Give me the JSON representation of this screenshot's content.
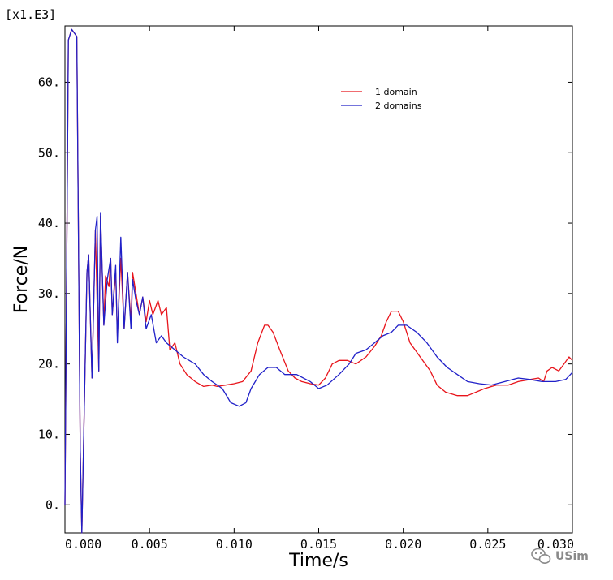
{
  "chart_data": {
    "type": "line",
    "xlabel": "Time/s",
    "ylabel": "Force/N",
    "y_multiplier": "[x1.E3]",
    "xlim": [
      0.0,
      0.03
    ],
    "ylim": [
      -4,
      68
    ],
    "x_ticks": [
      0.0,
      0.005,
      0.01,
      0.015,
      0.02,
      0.025,
      0.03
    ],
    "x_tick_labels": [
      "0.000",
      "0.005",
      "0.010",
      "0.015",
      "0.020",
      "0.025",
      "0.030"
    ],
    "y_ticks": [
      0,
      10,
      20,
      30,
      40,
      50,
      60
    ],
    "y_tick_labels": [
      "0.",
      "10.",
      "20.",
      "30.",
      "40.",
      "50.",
      "60."
    ],
    "grid": false,
    "legend_position": "top-right",
    "series": [
      {
        "name": "1 domain",
        "color": "#e8141b",
        "points": [
          [
            0.0,
            0
          ],
          [
            0.0002,
            66
          ],
          [
            0.0004,
            67.5
          ],
          [
            0.0007,
            66.5
          ],
          [
            0.0009,
            8
          ],
          [
            0.001,
            -4
          ],
          [
            0.0013,
            33
          ],
          [
            0.0014,
            35.5
          ],
          [
            0.0016,
            18
          ],
          [
            0.0018,
            39
          ],
          [
            0.002,
            19
          ],
          [
            0.0021,
            41
          ],
          [
            0.0023,
            25.5
          ],
          [
            0.0024,
            32.5
          ],
          [
            0.0026,
            31
          ],
          [
            0.0027,
            35
          ],
          [
            0.0028,
            27
          ],
          [
            0.003,
            33
          ],
          [
            0.0031,
            24
          ],
          [
            0.0033,
            35
          ],
          [
            0.0035,
            25
          ],
          [
            0.0037,
            33
          ],
          [
            0.0039,
            26
          ],
          [
            0.004,
            33
          ],
          [
            0.0042,
            30
          ],
          [
            0.0044,
            27
          ],
          [
            0.0046,
            29.5
          ],
          [
            0.0048,
            26
          ],
          [
            0.005,
            29
          ],
          [
            0.0052,
            27
          ],
          [
            0.0055,
            29
          ],
          [
            0.0057,
            27
          ],
          [
            0.006,
            28
          ],
          [
            0.0062,
            22
          ],
          [
            0.0065,
            23
          ],
          [
            0.0068,
            20
          ],
          [
            0.0072,
            18.5
          ],
          [
            0.0077,
            17.5
          ],
          [
            0.0082,
            16.8
          ],
          [
            0.0087,
            17
          ],
          [
            0.009,
            16.8
          ],
          [
            0.0095,
            17
          ],
          [
            0.01,
            17.2
          ],
          [
            0.0105,
            17.5
          ],
          [
            0.011,
            19
          ],
          [
            0.0114,
            23
          ],
          [
            0.0118,
            25.5
          ],
          [
            0.012,
            25.5
          ],
          [
            0.0123,
            24.5
          ],
          [
            0.0127,
            22
          ],
          [
            0.0132,
            19
          ],
          [
            0.0136,
            18
          ],
          [
            0.014,
            17.5
          ],
          [
            0.0145,
            17.2
          ],
          [
            0.015,
            17
          ],
          [
            0.0154,
            18
          ],
          [
            0.0158,
            20
          ],
          [
            0.0162,
            20.5
          ],
          [
            0.0167,
            20.5
          ],
          [
            0.0172,
            20
          ],
          [
            0.0178,
            21
          ],
          [
            0.0183,
            22.5
          ],
          [
            0.0187,
            24
          ],
          [
            0.019,
            26
          ],
          [
            0.0193,
            27.5
          ],
          [
            0.0197,
            27.5
          ],
          [
            0.02,
            26
          ],
          [
            0.0204,
            23
          ],
          [
            0.021,
            21
          ],
          [
            0.0216,
            19
          ],
          [
            0.022,
            17
          ],
          [
            0.0225,
            16
          ],
          [
            0.0232,
            15.5
          ],
          [
            0.0238,
            15.5
          ],
          [
            0.0243,
            16
          ],
          [
            0.0248,
            16.5
          ],
          [
            0.0255,
            17
          ],
          [
            0.0262,
            17
          ],
          [
            0.0268,
            17.5
          ],
          [
            0.0275,
            17.8
          ],
          [
            0.028,
            18
          ],
          [
            0.0283,
            17.5
          ],
          [
            0.0285,
            19
          ],
          [
            0.0288,
            19.5
          ],
          [
            0.0292,
            19
          ],
          [
            0.0295,
            20
          ],
          [
            0.0298,
            21
          ],
          [
            0.03,
            20.5
          ]
        ]
      },
      {
        "name": "2 domains",
        "color": "#2020c8",
        "points": [
          [
            0.0,
            0
          ],
          [
            0.0002,
            66
          ],
          [
            0.0004,
            67.5
          ],
          [
            0.0007,
            66.5
          ],
          [
            0.0009,
            8
          ],
          [
            0.001,
            -4
          ],
          [
            0.0013,
            33
          ],
          [
            0.0014,
            35.5
          ],
          [
            0.0016,
            18
          ],
          [
            0.0018,
            39
          ],
          [
            0.0019,
            41
          ],
          [
            0.002,
            19
          ],
          [
            0.0021,
            41.5
          ],
          [
            0.0023,
            25.5
          ],
          [
            0.0025,
            32
          ],
          [
            0.0027,
            35
          ],
          [
            0.0028,
            27
          ],
          [
            0.003,
            34
          ],
          [
            0.0031,
            23
          ],
          [
            0.0033,
            38
          ],
          [
            0.0035,
            25
          ],
          [
            0.0037,
            33
          ],
          [
            0.0039,
            25
          ],
          [
            0.004,
            32
          ],
          [
            0.0042,
            29
          ],
          [
            0.0044,
            27
          ],
          [
            0.0046,
            29.5
          ],
          [
            0.0048,
            25
          ],
          [
            0.0051,
            27
          ],
          [
            0.0054,
            23
          ],
          [
            0.0057,
            24
          ],
          [
            0.006,
            23
          ],
          [
            0.0065,
            22
          ],
          [
            0.007,
            21
          ],
          [
            0.0077,
            20
          ],
          [
            0.0082,
            18.5
          ],
          [
            0.0087,
            17.5
          ],
          [
            0.0093,
            16.5
          ],
          [
            0.0098,
            14.5
          ],
          [
            0.0103,
            14
          ],
          [
            0.0107,
            14.5
          ],
          [
            0.011,
            16.5
          ],
          [
            0.0115,
            18.5
          ],
          [
            0.012,
            19.5
          ],
          [
            0.0125,
            19.5
          ],
          [
            0.013,
            18.5
          ],
          [
            0.0137,
            18.5
          ],
          [
            0.0145,
            17.5
          ],
          [
            0.015,
            16.5
          ],
          [
            0.0155,
            17
          ],
          [
            0.0162,
            18.5
          ],
          [
            0.0168,
            20
          ],
          [
            0.0172,
            21.5
          ],
          [
            0.0178,
            22
          ],
          [
            0.0183,
            23
          ],
          [
            0.0188,
            24
          ],
          [
            0.0193,
            24.5
          ],
          [
            0.0197,
            25.5
          ],
          [
            0.0202,
            25.5
          ],
          [
            0.0208,
            24.5
          ],
          [
            0.0214,
            23
          ],
          [
            0.022,
            21
          ],
          [
            0.0226,
            19.5
          ],
          [
            0.0232,
            18.5
          ],
          [
            0.0238,
            17.5
          ],
          [
            0.0245,
            17.2
          ],
          [
            0.0252,
            17
          ],
          [
            0.026,
            17.5
          ],
          [
            0.0268,
            18
          ],
          [
            0.0275,
            17.8
          ],
          [
            0.0282,
            17.5
          ],
          [
            0.029,
            17.5
          ],
          [
            0.0296,
            17.8
          ],
          [
            0.03,
            18.8
          ]
        ]
      }
    ]
  },
  "watermark": {
    "text": "USim",
    "icon": "wechat-icon",
    "color": "#8a8a8a"
  }
}
